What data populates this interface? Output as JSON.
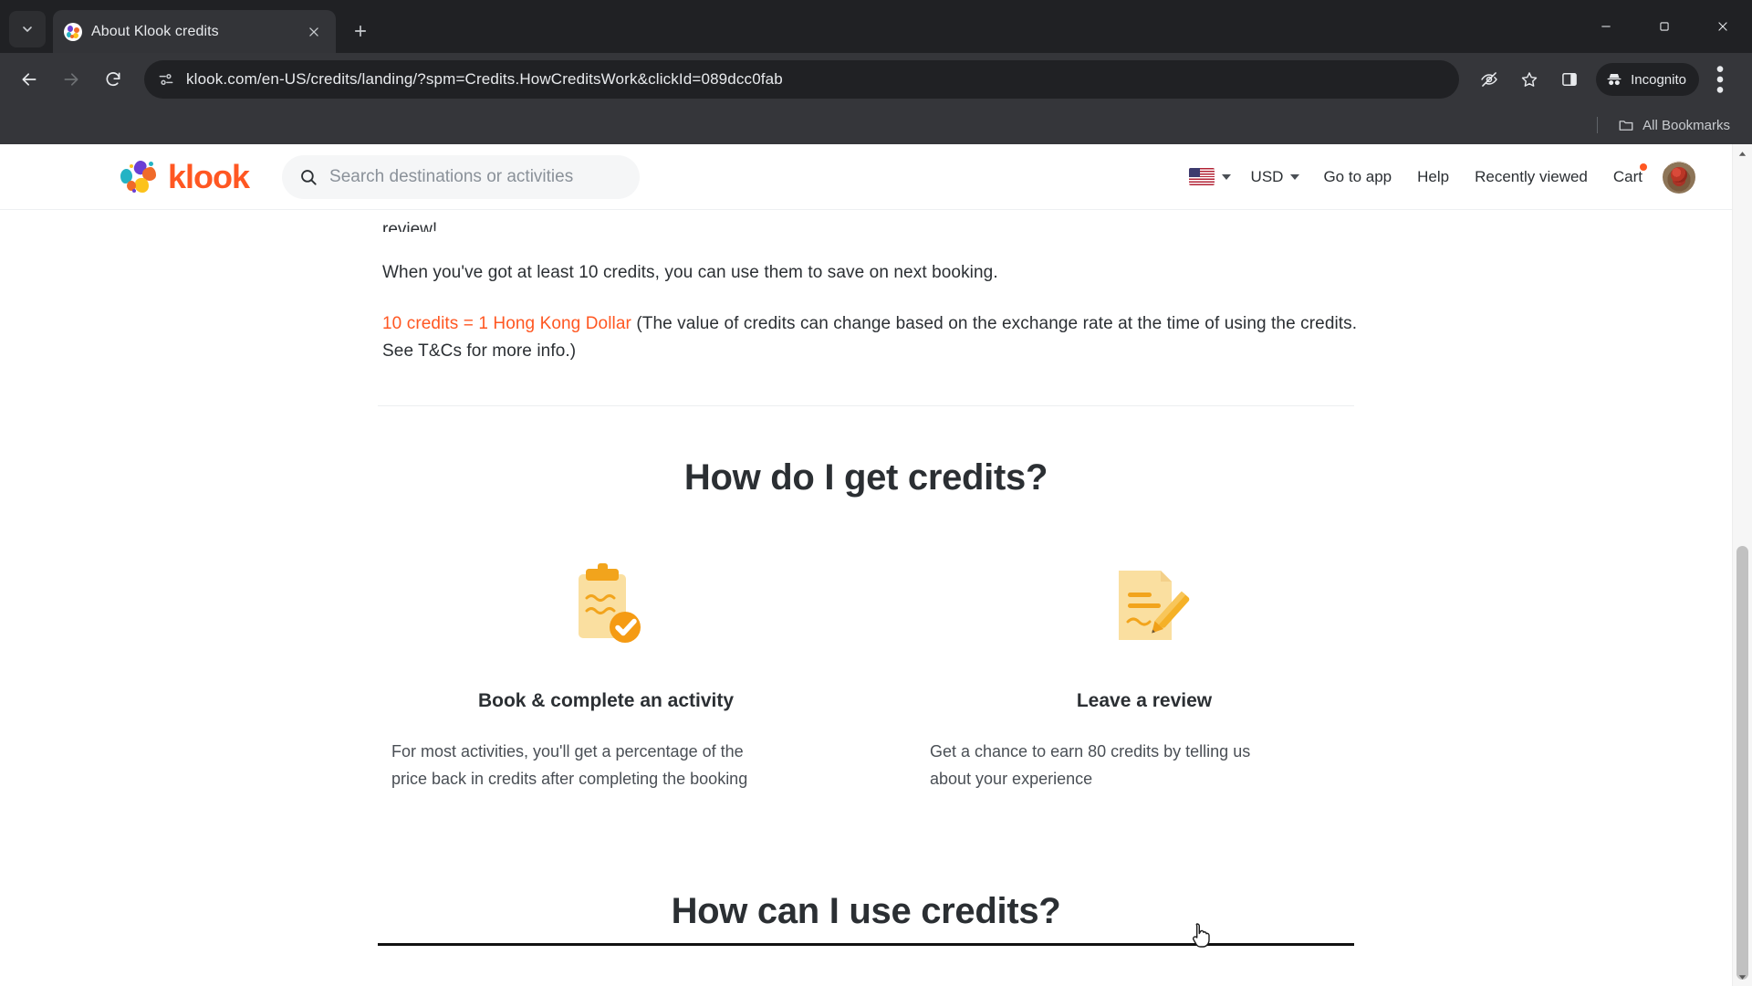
{
  "browser": {
    "tab": {
      "title": "About Klook credits",
      "favicon": "klook-favicon-icon",
      "close": "close-icon"
    },
    "new_tab_label": "+",
    "omnibox": {
      "url": "klook.com/en-US/credits/landing/?spm=Credits.HowCreditsWork&clickId=089dcc0fab",
      "site_settings_icon": "page-info-icon"
    },
    "toolbar_icons": [
      "eye-off-icon",
      "bookmark-star-icon",
      "side-panel-icon"
    ],
    "incognito_label": "Incognito",
    "menu_icon": "three-dot-menu-icon",
    "bookmarks": {
      "all_bookmarks_label": "All Bookmarks",
      "folder_icon": "folder-icon"
    },
    "window_controls": [
      "minimize",
      "maximize",
      "close"
    ],
    "nav": {
      "back": "back-arrow-icon",
      "forward": "forward-arrow-icon",
      "reload": "reload-icon"
    }
  },
  "site": {
    "brand": "klook",
    "search": {
      "placeholder": "Search destinations or activities",
      "icon": "search-icon"
    },
    "nav": {
      "language": {
        "flag": "us-flag-icon",
        "caret": "chevron-down-icon"
      },
      "currency": "USD",
      "items": [
        "Go to app",
        "Help",
        "Recently viewed",
        "Cart"
      ],
      "cart_badge": true,
      "avatar": "user-avatar"
    }
  },
  "main": {
    "clipped_line": "review!",
    "paragraph_1": "When you've got at least 10 credits, you can use them to save on next booking.",
    "paragraph_2_highlight": "10 credits = 1 Hong Kong Dollar",
    "paragraph_2_rest": " (The value of credits can change based on the exchange rate at the time of using the credits. See T&Cs for more info.)",
    "heading": "How do I get credits?",
    "cards": [
      {
        "icon": "clipboard-check-icon",
        "title": "Book & complete an activity",
        "body": "For most activities, you'll get a percentage of the price back in credits after completing the booking"
      },
      {
        "icon": "note-pencil-icon",
        "title": "Leave a review",
        "body": "Get a chance to earn 80 credits by telling us about your experience"
      }
    ],
    "bottom_heading": "How can I use credits?"
  },
  "colors": {
    "brand_orange": "#ff5722",
    "text_dark": "#2b2f33",
    "chrome_bg": "#202124"
  },
  "scrollbar": {
    "up_arrow": "scroll-up-icon",
    "down_arrow": "scroll-down-icon"
  }
}
